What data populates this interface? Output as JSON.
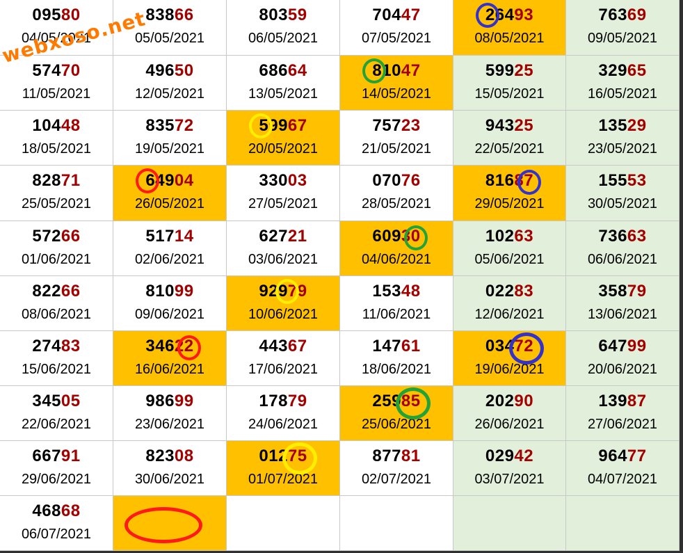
{
  "watermark": "webxoso.net",
  "colors": {
    "orange": "#ffc000",
    "green": "#e2efda",
    "white": "#ffffff",
    "tail": "#a30000",
    "red": "#ff1a1a",
    "blue": "#3333cc",
    "green_mark": "#22a33a",
    "yellow": "#ffee00"
  },
  "rows": [
    [
      {
        "head": "095",
        "tail": "80",
        "date": "04/05/2021",
        "bg": "white"
      },
      {
        "head": "838",
        "tail": "66",
        "date": "05/05/2021",
        "bg": "white"
      },
      {
        "head": "803",
        "tail": "59",
        "date": "06/05/2021",
        "bg": "white"
      },
      {
        "head": "704",
        "tail": "47",
        "date": "07/05/2021",
        "bg": "white"
      },
      {
        "head": "264",
        "tail": "93",
        "date": "08/05/2021",
        "bg": "orange",
        "mark": {
          "color": "blue",
          "col": "c0"
        }
      },
      {
        "head": "763",
        "tail": "69",
        "date": "09/05/2021",
        "bg": "green"
      }
    ],
    [
      {
        "head": "574",
        "tail": "70",
        "date": "11/05/2021",
        "bg": "white"
      },
      {
        "head": "496",
        "tail": "50",
        "date": "12/05/2021",
        "bg": "white"
      },
      {
        "head": "686",
        "tail": "64",
        "date": "13/05/2021",
        "bg": "white"
      },
      {
        "head": "810",
        "tail": "47",
        "date": "14/05/2021",
        "bg": "orange",
        "mark": {
          "color": "green_mark",
          "col": "c0"
        }
      },
      {
        "head": "599",
        "tail": "25",
        "date": "15/05/2021",
        "bg": "green"
      },
      {
        "head": "329",
        "tail": "65",
        "date": "16/05/2021",
        "bg": "green"
      }
    ],
    [
      {
        "head": "104",
        "tail": "48",
        "date": "18/05/2021",
        "bg": "white"
      },
      {
        "head": "835",
        "tail": "72",
        "date": "19/05/2021",
        "bg": "white"
      },
      {
        "head": "599",
        "tail": "67",
        "date": "20/05/2021",
        "bg": "orange",
        "mark": {
          "color": "yellow",
          "col": "c0"
        }
      },
      {
        "head": "757",
        "tail": "23",
        "date": "21/05/2021",
        "bg": "white"
      },
      {
        "head": "943",
        "tail": "25",
        "date": "22/05/2021",
        "bg": "green"
      },
      {
        "head": "135",
        "tail": "29",
        "date": "23/05/2021",
        "bg": "green"
      }
    ],
    [
      {
        "head": "828",
        "tail": "71",
        "date": "25/05/2021",
        "bg": "white"
      },
      {
        "head": "649",
        "tail": "04",
        "date": "26/05/2021",
        "bg": "orange",
        "mark": {
          "color": "red",
          "col": "c0"
        }
      },
      {
        "head": "330",
        "tail": "03",
        "date": "27/05/2021",
        "bg": "white"
      },
      {
        "head": "070",
        "tail": "76",
        "date": "28/05/2021",
        "bg": "white"
      },
      {
        "head": "816",
        "tail": "87",
        "date": "29/05/2021",
        "bg": "orange",
        "mark": {
          "color": "blue",
          "col": "c4"
        }
      },
      {
        "head": "155",
        "tail": "53",
        "date": "30/05/2021",
        "bg": "green"
      }
    ],
    [
      {
        "head": "572",
        "tail": "66",
        "date": "01/06/2021",
        "bg": "white"
      },
      {
        "head": "517",
        "tail": "14",
        "date": "02/06/2021",
        "bg": "white"
      },
      {
        "head": "627",
        "tail": "21",
        "date": "03/06/2021",
        "bg": "white"
      },
      {
        "head": "609",
        "tail": "30",
        "date": "04/06/2021",
        "bg": "orange",
        "mark": {
          "color": "green_mark",
          "col": "c4"
        }
      },
      {
        "head": "102",
        "tail": "63",
        "date": "05/06/2021",
        "bg": "green"
      },
      {
        "head": "736",
        "tail": "63",
        "date": "06/06/2021",
        "bg": "green"
      }
    ],
    [
      {
        "head": "822",
        "tail": "66",
        "date": "08/06/2021",
        "bg": "white"
      },
      {
        "head": "810",
        "tail": "99",
        "date": "09/06/2021",
        "bg": "white"
      },
      {
        "head": "929",
        "tail": "79",
        "date": "10/06/2021",
        "bg": "orange",
        "mark": {
          "color": "yellow",
          "col": "c3"
        }
      },
      {
        "head": "153",
        "tail": "48",
        "date": "11/06/2021",
        "bg": "white"
      },
      {
        "head": "022",
        "tail": "83",
        "date": "12/06/2021",
        "bg": "green"
      },
      {
        "head": "358",
        "tail": "79",
        "date": "13/06/2021",
        "bg": "green"
      }
    ],
    [
      {
        "head": "274",
        "tail": "83",
        "date": "15/06/2021",
        "bg": "white"
      },
      {
        "head": "346",
        "tail": "22",
        "date": "16/06/2021",
        "bg": "orange",
        "mark": {
          "color": "red",
          "col": "c4"
        }
      },
      {
        "head": "443",
        "tail": "67",
        "date": "17/06/2021",
        "bg": "white"
      },
      {
        "head": "147",
        "tail": "61",
        "date": "18/06/2021",
        "bg": "white"
      },
      {
        "head": "034",
        "tail": "72",
        "date": "19/06/2021",
        "bg": "orange",
        "mark": {
          "color": "blue",
          "col": "tail"
        }
      },
      {
        "head": "647",
        "tail": "99",
        "date": "20/06/2021",
        "bg": "green"
      }
    ],
    [
      {
        "head": "345",
        "tail": "05",
        "date": "22/06/2021",
        "bg": "white"
      },
      {
        "head": "986",
        "tail": "99",
        "date": "23/06/2021",
        "bg": "white"
      },
      {
        "head": "178",
        "tail": "79",
        "date": "24/06/2021",
        "bg": "white"
      },
      {
        "head": "259",
        "tail": "85",
        "date": "25/06/2021",
        "bg": "orange",
        "mark": {
          "color": "green_mark",
          "col": "tail"
        }
      },
      {
        "head": "202",
        "tail": "90",
        "date": "26/06/2021",
        "bg": "green"
      },
      {
        "head": "139",
        "tail": "87",
        "date": "27/06/2021",
        "bg": "green"
      }
    ],
    [
      {
        "head": "667",
        "tail": "91",
        "date": "29/06/2021",
        "bg": "white"
      },
      {
        "head": "823",
        "tail": "08",
        "date": "30/06/2021",
        "bg": "white"
      },
      {
        "head": "012",
        "tail": "75",
        "date": "01/07/2021",
        "bg": "orange",
        "mark": {
          "color": "yellow",
          "col": "tail"
        }
      },
      {
        "head": "877",
        "tail": "81",
        "date": "02/07/2021",
        "bg": "white"
      },
      {
        "head": "029",
        "tail": "42",
        "date": "03/07/2021",
        "bg": "green"
      },
      {
        "head": "964",
        "tail": "77",
        "date": "04/07/2021",
        "bg": "green"
      }
    ],
    [
      {
        "head": "468",
        "tail": "68",
        "date": "06/07/2021",
        "bg": "white"
      },
      {
        "head": "",
        "tail": "",
        "date": "",
        "bg": "orange",
        "mark": {
          "color": "red",
          "col": "empty"
        }
      },
      {
        "head": "",
        "tail": "",
        "date": "",
        "bg": "white"
      },
      {
        "head": "",
        "tail": "",
        "date": "",
        "bg": "white"
      },
      {
        "head": "",
        "tail": "",
        "date": "",
        "bg": "green"
      },
      {
        "head": "",
        "tail": "",
        "date": "",
        "bg": "green"
      }
    ]
  ]
}
